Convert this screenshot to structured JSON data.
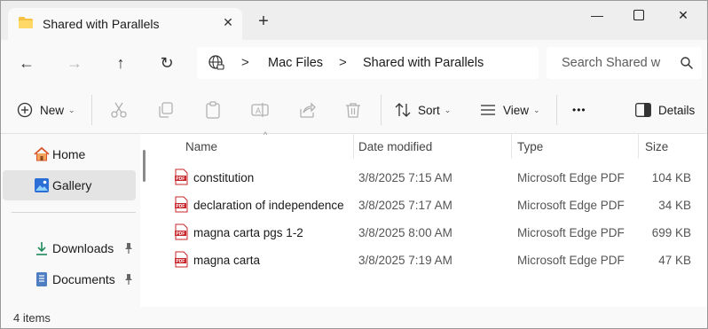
{
  "tab": {
    "title": "Shared with Parallels",
    "close_glyph": "✕",
    "new_tab_glyph": "+"
  },
  "window_controls": {
    "minimize_glyph": "—",
    "maximize_glyph": "☐",
    "close_glyph": "✕"
  },
  "nav": {
    "back_glyph": "←",
    "forward_glyph": "→",
    "up_glyph": "↑",
    "refresh_glyph": "↻"
  },
  "address": {
    "icon": "network-globe-icon",
    "separator": ">",
    "crumbs": [
      "Mac Files",
      "Shared with Parallels"
    ]
  },
  "search": {
    "placeholder": "Search Shared w"
  },
  "commands": {
    "new_label": "New",
    "sort_label": "Sort",
    "view_label": "View",
    "more_label": "•••",
    "details_label": "Details",
    "chevron": "⌄"
  },
  "sidebar": {
    "items": [
      {
        "label": "Home",
        "icon": "home-icon",
        "selected": false,
        "pinned": false
      },
      {
        "label": "Gallery",
        "icon": "gallery-icon",
        "selected": true,
        "pinned": false
      },
      {
        "label": "Downloads",
        "icon": "downloads-icon",
        "selected": false,
        "pinned": true
      },
      {
        "label": "Documents",
        "icon": "documents-icon",
        "selected": false,
        "pinned": true
      }
    ]
  },
  "table": {
    "headers": {
      "name": "Name",
      "date": "Date modified",
      "type": "Type",
      "size": "Size"
    },
    "sort_caret": "^",
    "rows": [
      {
        "name": "constitution",
        "date": "3/8/2025 7:15 AM",
        "type": "Microsoft Edge PDF",
        "size": "104 KB"
      },
      {
        "name": "declaration of independence",
        "date": "3/8/2025 7:17 AM",
        "type": "Microsoft Edge PDF",
        "size": "34 KB"
      },
      {
        "name": "magna carta pgs 1-2",
        "date": "3/8/2025 8:00 AM",
        "type": "Microsoft Edge PDF",
        "size": "699 KB"
      },
      {
        "name": "magna carta",
        "date": "3/8/2025 7:19 AM",
        "type": "Microsoft Edge PDF",
        "size": "47 KB"
      }
    ]
  },
  "status": {
    "item_count": "4 items"
  },
  "colors": {
    "pdf_red": "#c7262d",
    "folder_yellow": "#f5c242",
    "accent_blue": "#2b6fd6"
  }
}
